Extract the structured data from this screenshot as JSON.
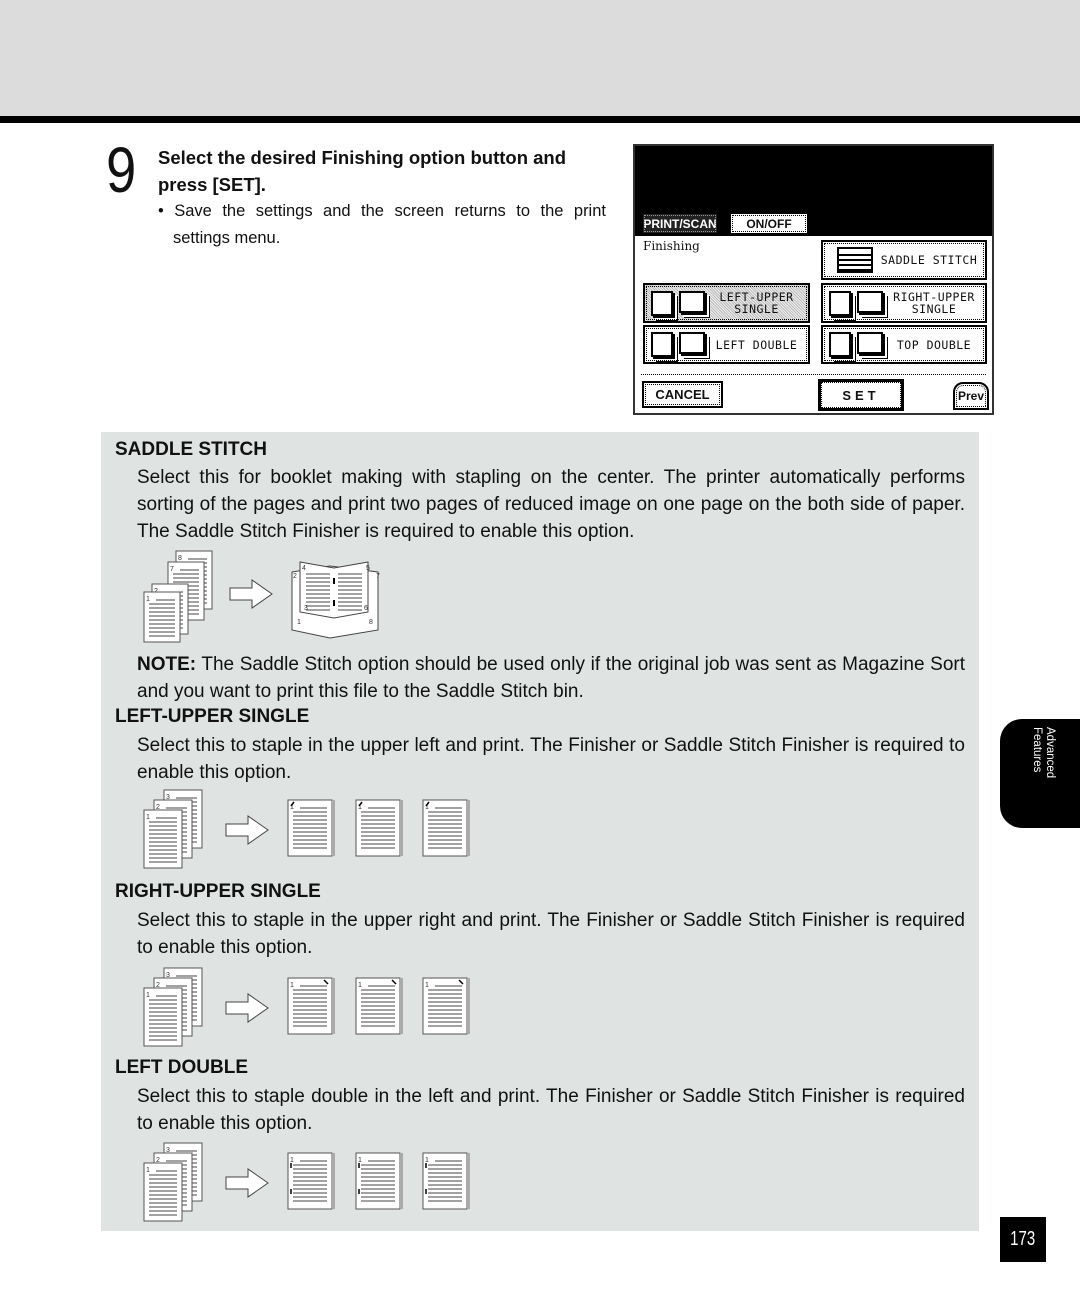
{
  "step": {
    "number": "9",
    "heading": "Select the desired Finishing option button and press [SET].",
    "bullet": "Save the settings and the screen returns to the print settings menu."
  },
  "lcd": {
    "tabs": [
      {
        "label": "PRINT/SCAN",
        "active": true
      },
      {
        "label": "ON/OFF",
        "active": false
      }
    ],
    "screen_label": "Finishing",
    "buttons": {
      "saddle_stitch": "SADDLE STITCH",
      "left_upper": "LEFT-UPPER SINGLE",
      "right_upper": "RIGHT-UPPER SINGLE",
      "left_double": "LEFT DOUBLE",
      "top_double": "TOP DOUBLE"
    },
    "selected": "LEFT-UPPER SINGLE",
    "cancel": "CANCEL",
    "set": "SET",
    "prev": "Prev"
  },
  "sections": [
    {
      "title": "SADDLE STITCH",
      "text": "Select this for booklet making with stapling on the center.  The printer automatically performs sorting of the pages and print two pages of reduced image on one page on the both side of paper.  The Saddle Stitch Finisher is required to enable this option.",
      "note_label": "NOTE:",
      "note": " The Saddle Stitch option should be used only if the original job was sent as Magazine Sort and you want to print this file to the Saddle Stitch bin.",
      "stack_labels": [
        "8",
        "7",
        "2",
        "1"
      ],
      "booklet_labels": [
        "4",
        "5",
        "2",
        "7",
        "3",
        "6",
        "1",
        "8"
      ]
    },
    {
      "title": "LEFT-UPPER SINGLE",
      "text": "Select this to staple in the upper left and print.  The Finisher or Saddle Stitch Finisher is required to enable this option.",
      "stack_labels": [
        "3",
        "2",
        "1"
      ],
      "output_label": "1"
    },
    {
      "title": "RIGHT-UPPER SINGLE",
      "text": "Select this to staple in the upper right and print.  The Finisher or Saddle Stitch Finisher is required to enable this option.",
      "stack_labels": [
        "3",
        "2",
        "1"
      ],
      "output_label": "1"
    },
    {
      "title": "LEFT DOUBLE",
      "text": "Select this to staple double in the left and print.  The Finisher or Saddle Stitch Finisher is required to enable this option.",
      "stack_labels": [
        "3",
        "2",
        "1"
      ],
      "output_label": "1"
    }
  ],
  "side_tab": "Advanced\nFeatures",
  "page_number": "173"
}
